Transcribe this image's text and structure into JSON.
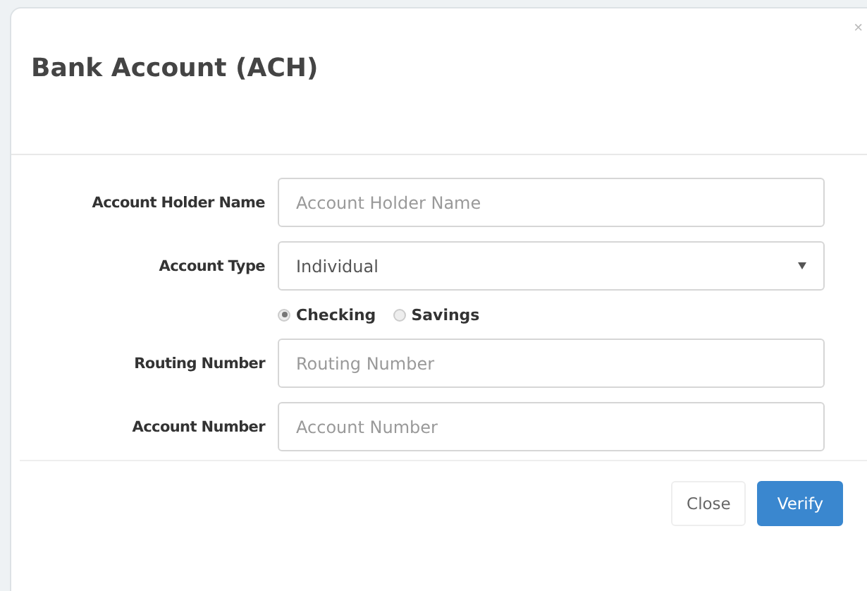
{
  "dialog": {
    "title": "Bank Account (ACH)",
    "close_glyph": "×"
  },
  "fields": [
    {
      "kind": "input",
      "label": "Account Holder Name",
      "placeholder": "Account Holder Name"
    },
    {
      "kind": "select",
      "label": "Account Type",
      "value": "Individual"
    },
    {
      "kind": "radios",
      "options": [
        {
          "label": "Checking",
          "selected": true
        },
        {
          "label": "Savings",
          "selected": false
        }
      ]
    },
    {
      "kind": "input",
      "label": "Routing Number",
      "placeholder": "Routing Number"
    },
    {
      "kind": "input",
      "label": "Account Number",
      "placeholder": "Account Number"
    }
  ],
  "buttons": [
    {
      "kind": "default",
      "label": "Close"
    },
    {
      "kind": "primary",
      "label": "Verify"
    }
  ]
}
